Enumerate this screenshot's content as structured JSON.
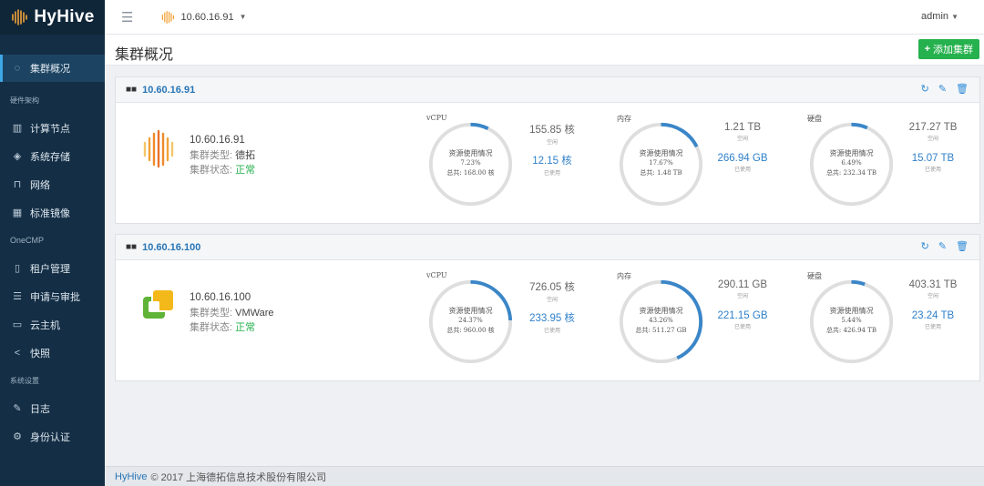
{
  "app": {
    "brand": "HyHive",
    "current_cluster": "10.60.16.91",
    "user": "admin"
  },
  "sidebar": {
    "active": "集群概况",
    "sections": [
      {
        "title": "硬件架构",
        "items": [
          "计算节点",
          "系统存储",
          "网络",
          "标准镜像"
        ]
      },
      {
        "title": "OneCMP",
        "items": [
          "租户管理",
          "申请与审批",
          "云主机",
          "快照"
        ]
      },
      {
        "title": "系统设置",
        "items": [
          "日志",
          "身份认证"
        ]
      }
    ]
  },
  "page": {
    "title": "集群概况",
    "add_button": "添加集群"
  },
  "labels": {
    "type": "集群类型:",
    "status": "集群状态:",
    "free": "空闲",
    "used": "已使用",
    "usage": "资源使用情况"
  },
  "clusters": [
    {
      "ip": "10.60.16.91",
      "name": "10.60.16.91",
      "type": "德拓",
      "status": "正常",
      "logo": "hyhive-logo",
      "metrics": [
        {
          "title": "vCPU",
          "percent": "7.23%",
          "fraction": 0.0723,
          "total": "总共: 168.00 核",
          "free": "155.85 核",
          "used": "12.15 核"
        },
        {
          "title": "内存",
          "percent": "17.67%",
          "fraction": 0.1767,
          "total": "总共: 1.48 TB",
          "free": "1.21 TB",
          "used": "266.94 GB"
        },
        {
          "title": "硬盘",
          "percent": "6.49%",
          "fraction": 0.0649,
          "total": "总共: 232.34 TB",
          "free": "217.27 TB",
          "used": "15.07 TB"
        }
      ]
    },
    {
      "ip": "10.60.16.100",
      "name": "10.60.16.100",
      "type": "VMWare",
      "status": "正常",
      "logo": "vmware-logo",
      "metrics": [
        {
          "title": "vCPU",
          "percent": "24.37%",
          "fraction": 0.2437,
          "total": "总共: 960.00 核",
          "free": "726.05 核",
          "used": "233.95 核"
        },
        {
          "title": "内存",
          "percent": "43.26%",
          "fraction": 0.4326,
          "total": "总共: 511.27 GB",
          "free": "290.11 GB",
          "used": "221.15 GB"
        },
        {
          "title": "硬盘",
          "percent": "5.44%",
          "fraction": 0.0544,
          "total": "总共: 426.94 TB",
          "free": "403.31 TB",
          "used": "23.24 TB"
        }
      ]
    }
  ],
  "footer": {
    "brand": "HyHive",
    "text": "© 2017 上海德拓信息技术股份有限公司"
  },
  "colors": {
    "sidebar": "#132e45",
    "accent": "#2f80c9",
    "ok": "#27b14f",
    "add": "#25b14d",
    "ring_track": "#dedede",
    "ring_fill": "#3a86c8"
  }
}
